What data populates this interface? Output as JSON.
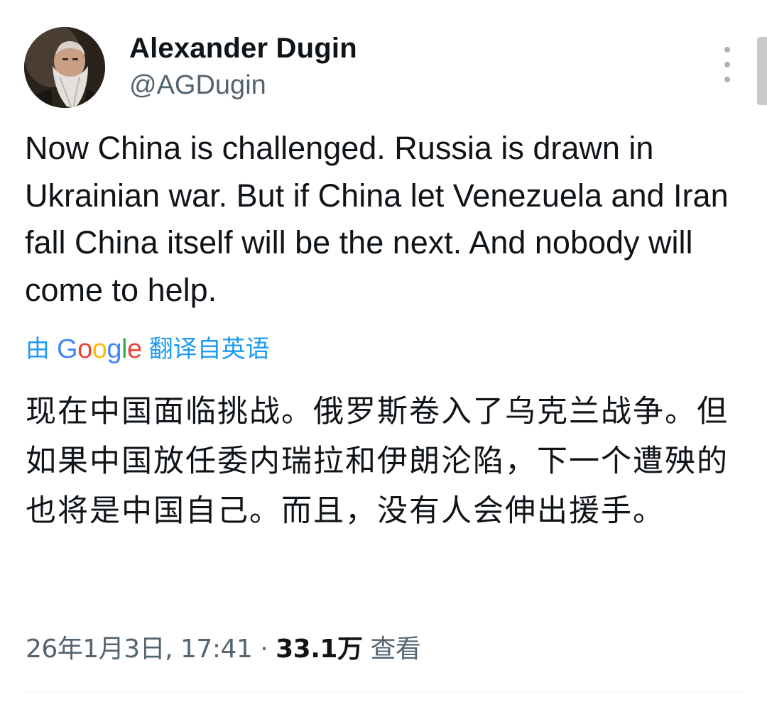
{
  "author": {
    "display_name": "Alexander Dugin",
    "handle": "@AGDugin"
  },
  "tweet": {
    "text": "Now China is challenged. Russia is drawn in Ukrainian war. But if China let Venezuela and Iran fall China itself will be the next. And nobody will come to help.",
    "translation_prefix": "由",
    "translation_provider": "Google",
    "translation_suffix": "翻译自英语",
    "translated_text": "现在中国面临挑战。俄罗斯卷入了乌克兰战争。但如果中国放任委内瑞拉和伊朗沦陷，下一个遭殃的也将是中国自己。而且，没有人会伸出援手。"
  },
  "meta": {
    "date_time": "26年1月3日, 17:41",
    "separator": "·",
    "views_count": "33.1万",
    "views_label": "查看"
  },
  "colors": {
    "accent": "#1d9bf0",
    "text_primary": "#0f1419",
    "text_secondary": "#536471",
    "google_blue": "#4285f4",
    "google_red": "#ea4335",
    "google_yellow": "#fbbc05",
    "google_green": "#34a853"
  },
  "icons": {
    "more": "more-vertical-icon",
    "avatar": "profile-photo"
  }
}
